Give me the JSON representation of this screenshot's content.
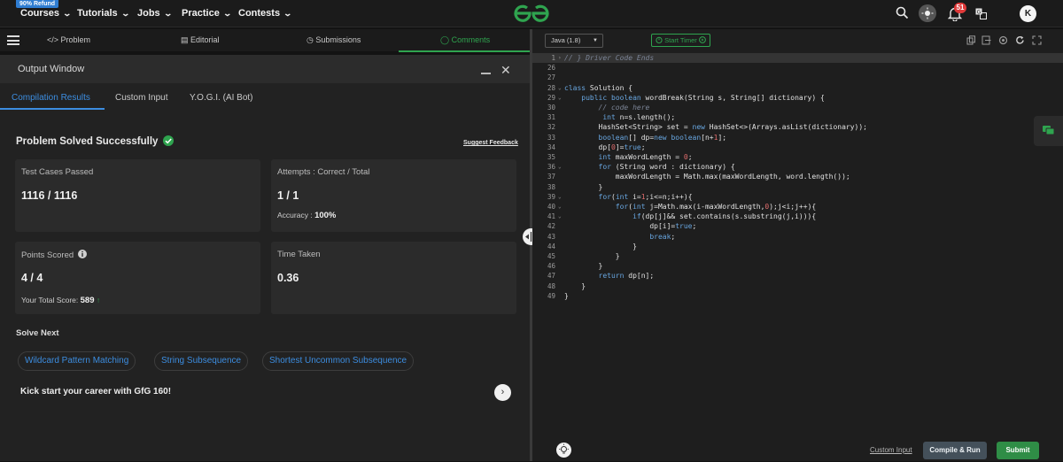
{
  "topnav": {
    "refund_badge": "90% Refund",
    "items": [
      "Courses",
      "Tutorials",
      "Jobs",
      "Practice",
      "Contests"
    ],
    "notification_count": "51",
    "avatar_letter": "K"
  },
  "problem_tabs": {
    "items": [
      "Problem",
      "Editorial",
      "Submissions",
      "Comments"
    ],
    "active": "Comments"
  },
  "output": {
    "title": "Output Window",
    "tabs": [
      "Compilation Results",
      "Custom Input",
      "Y.O.G.I. (AI Bot)"
    ],
    "status": "Problem Solved Successfully",
    "suggest_feedback": "Suggest Feedback",
    "cards": {
      "test_cases_label": "Test Cases Passed",
      "test_cases_value": "1116 / 1116",
      "attempts_label": "Attempts : Correct / Total",
      "attempts_value": "1 / 1",
      "accuracy_label": "Accuracy :",
      "accuracy_value": "100%",
      "points_label": "Points Scored",
      "points_value": "4 / 4",
      "total_score_label": "Your Total Score:",
      "total_score_value": "589",
      "time_label": "Time Taken",
      "time_value": "0.36"
    },
    "solve_next_label": "Solve Next",
    "solve_next": [
      "Wildcard Pattern Matching",
      "String Subsequence",
      "Shortest Uncommon Subsequence"
    ],
    "promo": "Kick start your career with GfG 160!"
  },
  "editor": {
    "language": "Java (1.8)",
    "timer_label": "Start Timer",
    "line_numbers": [
      "1",
      "26",
      "27",
      "28",
      "29",
      "30",
      "31",
      "32",
      "33",
      "34",
      "35",
      "36",
      "37",
      "38",
      "39",
      "40",
      "41",
      "42",
      "43",
      "44",
      "45",
      "46",
      "47",
      "48",
      "49"
    ],
    "code_lines": [
      "// } Driver Code Ends",
      "",
      "",
      "class Solution {",
      "    public boolean wordBreak(String s, String[] dictionary) {",
      "        // code here",
      "         int n=s.length();",
      "        HashSet<String> set = new HashSet<>(Arrays.asList(dictionary));",
      "        boolean[] dp=new boolean[n+1];",
      "        dp[0]=true;",
      "        int maxWordLength = 0;",
      "        for (String word : dictionary) {",
      "            maxWordLength = Math.max(maxWordLength, word.length());",
      "        }",
      "        for(int i=1;i<=n;i++){",
      "            for(int j=Math.max(i-maxWordLength,0);j<i;j++){",
      "                if(dp[j]&& set.contains(s.substring(j,i))){",
      "                    dp[i]=true;",
      "                    break;",
      "                }",
      "            }",
      "        }",
      "        return dp[n];",
      "    }",
      "}"
    ],
    "custom_input": "Custom Input",
    "compile_run": "Compile & Run",
    "submit": "Submit"
  },
  "colors": {
    "accent_green": "#2fa44f",
    "accent_blue": "#3c8de0",
    "badge_red": "#e03a3a"
  }
}
